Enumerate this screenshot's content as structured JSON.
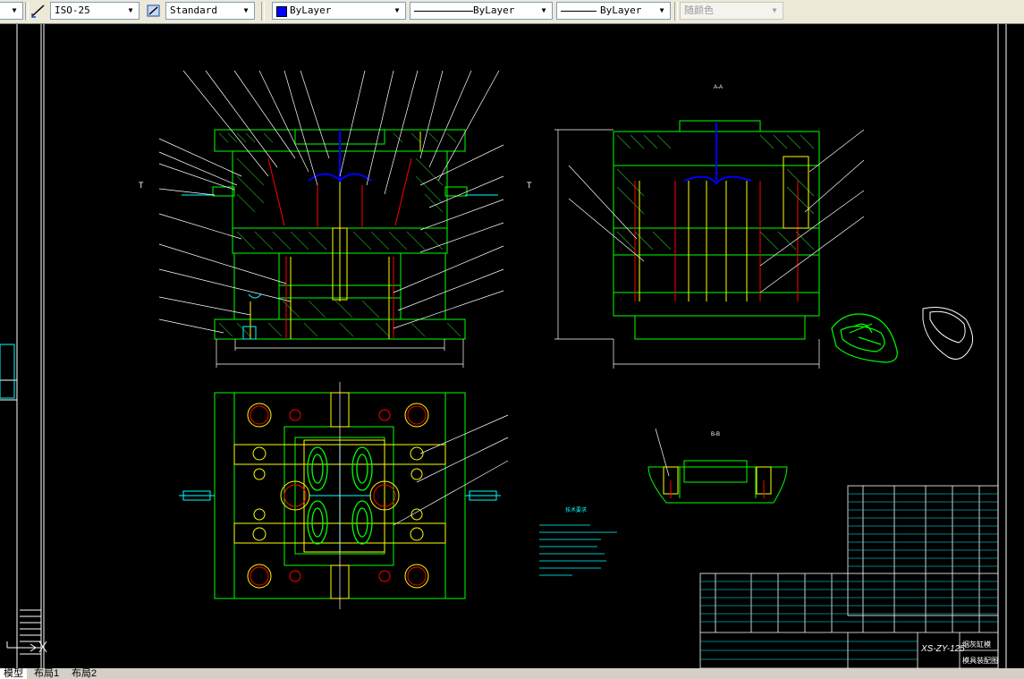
{
  "toolbar": {
    "layer_combo_value": "",
    "dimstyle_label": "ISO-25",
    "textstyle_label": "Standard",
    "color_label": "ByLayer",
    "color_swatch": "#0000ff",
    "linetype_label": "ByLayer",
    "lineweight_label": "ByLayer",
    "plotstyle_label": "随颜色"
  },
  "drawing": {
    "background": "#000000",
    "primary_color": "#00ff00",
    "cyan_color": "#00ffff",
    "red_color": "#ff0000",
    "blue_color": "#0000ff",
    "yellow_color": "#ffff00",
    "white_color": "#ffffff",
    "title_block_model": "XS-ZY-125",
    "title_block_name_1": "烟灰缸模",
    "title_block_name_2": "模具装配图",
    "section_a_label": "A-A",
    "section_b_label": "B-B",
    "tech_requirements_title": "技术要求",
    "left_t_label": "T",
    "right_t_label": "T"
  },
  "tabs": {
    "model": "模型",
    "layout1": "布局1",
    "layout2": "布局2"
  }
}
